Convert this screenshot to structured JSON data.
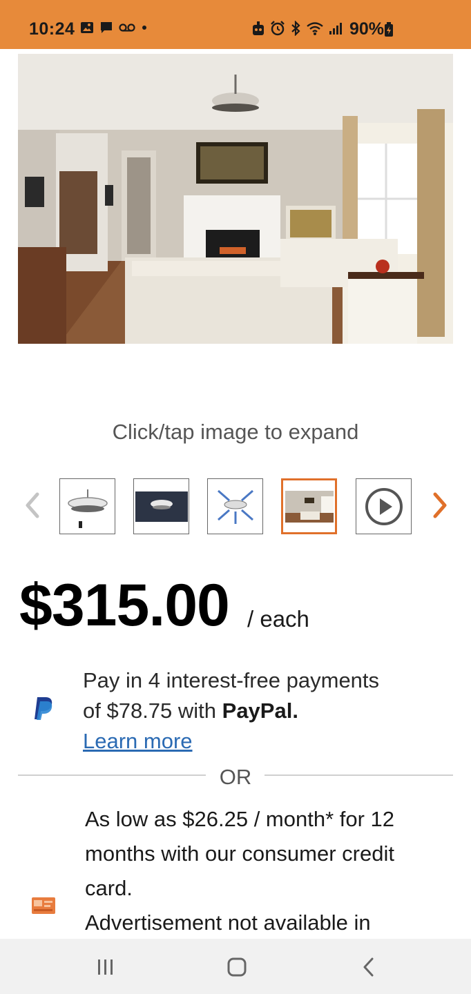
{
  "status_bar": {
    "time": "10:24",
    "battery": "90%",
    "background": "#e78a3a"
  },
  "gallery": {
    "hint": "Click/tap image to expand",
    "thumbnails": [
      {
        "icon": "fan-product-icon"
      },
      {
        "icon": "fan-ceiling-icon"
      },
      {
        "icon": "fan-airflow-icon"
      },
      {
        "icon": "room-scene-icon",
        "selected": true
      },
      {
        "icon": "play-video-icon"
      }
    ]
  },
  "price": {
    "amount": "$315.00",
    "unit": "/ each"
  },
  "paypal": {
    "line1": "Pay in 4 interest-free payments",
    "line2_prefix": "of $78.75 with ",
    "brand": "PayPal.",
    "learn_more": "Learn more"
  },
  "divider": {
    "label": "OR"
  },
  "credit": {
    "text1": "As low as $26.25 / month* for 12 months with our consumer credit card.",
    "text2": "Advertisement not available in"
  },
  "accent_color": "#e0702a",
  "link_color": "#2a6ab3"
}
